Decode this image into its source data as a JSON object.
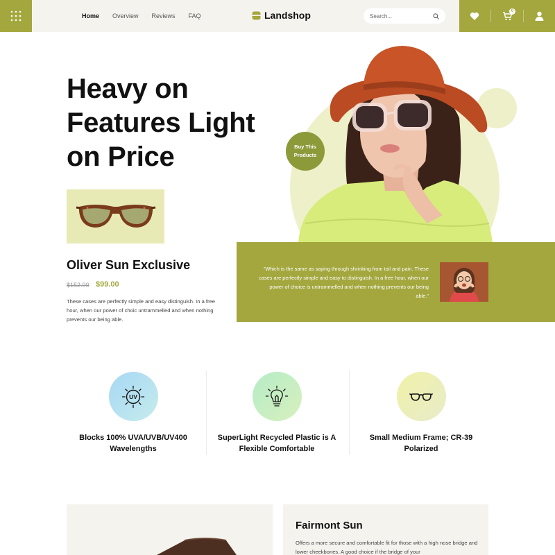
{
  "brand": {
    "name": "Landshop",
    "accent": "#a3a73e",
    "accent_light": "#e8eab5"
  },
  "nav": {
    "items": [
      "Home",
      "Overview",
      "Reviews",
      "FAQ"
    ],
    "active": "Home"
  },
  "search": {
    "placeholder": "Search..."
  },
  "header_icons": [
    "grid-menu-icon",
    "heart-icon",
    "cart-icon",
    "user-icon"
  ],
  "cart": {
    "count": "0"
  },
  "hero": {
    "title": "Heavy on Features Light on Price",
    "badge": "Buy This Products"
  },
  "product": {
    "name": "Oliver Sun Exclusive",
    "old_price": "$152.00",
    "price": "$99.00",
    "description": "These cases are perfectly simple and easy distinguish. In a free hour, when our power of choic untrammelled and when nothing prevents our being able."
  },
  "testimonial": {
    "quote": "\"Which is the same as saying through shrinking from toil and pain. These cases are perfectly simple and easy to distinguish. In a free hour, when our power of choice is untrammelled and when nothing prevents our being able.\""
  },
  "features": [
    {
      "icon": "uv-sun-icon",
      "label": "Blocks 100% UVA/UVB/UV400 Wavelengths",
      "color": "#bfe4ee"
    },
    {
      "icon": "lightbulb-icon",
      "label": "SuperLight Recycled Plastic is A Flexible Comfortable",
      "color": "#c6ecc9"
    },
    {
      "icon": "glasses-icon",
      "label": "Small Medium Frame; CR-39 Polarized",
      "color": "#eef0b3"
    }
  ],
  "fairmont": {
    "title": "Fairmont Sun",
    "description": "Offers a more secure and comfortable fit for those with a high nose bridge and lower cheekbones. A good choice if the bridge of your"
  }
}
